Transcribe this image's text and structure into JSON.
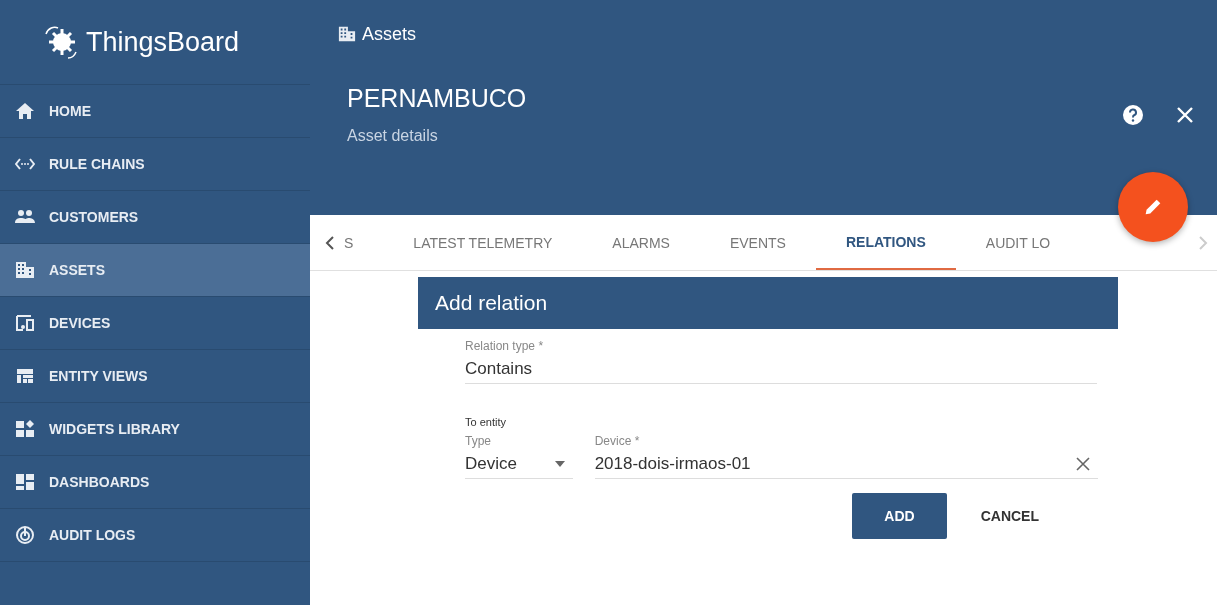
{
  "sidebar": {
    "logo": "ThingsBoard",
    "items": [
      {
        "label": "HOME",
        "selected": false
      },
      {
        "label": "RULE CHAINS",
        "selected": false
      },
      {
        "label": "CUSTOMERS",
        "selected": false
      },
      {
        "label": "ASSETS",
        "selected": true
      },
      {
        "label": "DEVICES",
        "selected": false
      },
      {
        "label": "ENTITY VIEWS",
        "selected": false
      },
      {
        "label": "WIDGETS LIBRARY",
        "selected": false
      },
      {
        "label": "DASHBOARDS",
        "selected": false
      },
      {
        "label": "AUDIT LOGS",
        "selected": false
      }
    ]
  },
  "breadcrumb": "Assets",
  "details": {
    "title": "PERNAMBUCO",
    "subtitle": "Asset details"
  },
  "tabs": [
    {
      "label": "S",
      "selected": false
    },
    {
      "label": "LATEST TELEMETRY",
      "selected": false
    },
    {
      "label": "ALARMS",
      "selected": false
    },
    {
      "label": "EVENTS",
      "selected": false
    },
    {
      "label": "RELATIONS",
      "selected": true
    },
    {
      "label": "AUDIT LO",
      "selected": false
    }
  ],
  "dialog": {
    "title": "Add relation",
    "relation_type": {
      "label": "Relation type *",
      "value": "Contains"
    },
    "to_entity": "To entity",
    "type": {
      "label": "Type",
      "value": "Device"
    },
    "device": {
      "label": "Device *",
      "value": "2018-dois-irmaos-01"
    },
    "buttons": [
      {
        "label": "ADD",
        "kind": "primary"
      },
      {
        "label": "CANCEL",
        "kind": "flat"
      }
    ]
  }
}
